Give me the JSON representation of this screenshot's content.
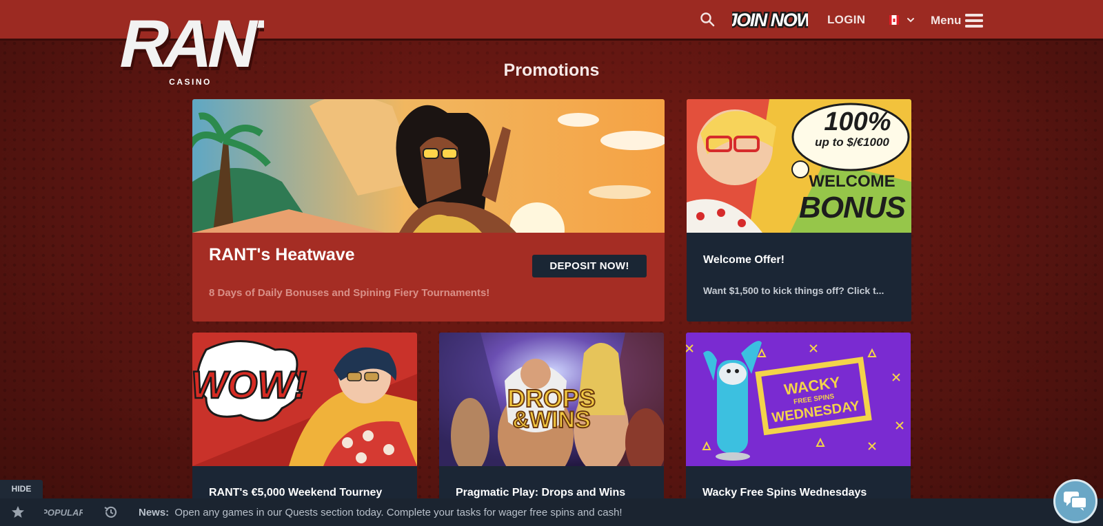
{
  "header": {
    "logo_text": "RANT",
    "logo_sub": "CASINO",
    "join_label": "JOIN NOW",
    "login_label": "LOGIN",
    "menu_label": "Menu"
  },
  "page": {
    "title": "Promotions"
  },
  "promotions": [
    {
      "title": "RANT's Heatwave",
      "subtitle": "8 Days of Daily Bonuses and Spining Fiery Tournaments!",
      "button": "DEPOSIT NOW!"
    },
    {
      "title": "Welcome Offer!",
      "subtitle": "Want $1,500 to kick things off? Click t...",
      "banner_line1": "100%",
      "banner_line2": "up to $/€1000",
      "banner_line3": "WELCOME",
      "banner_line4": "BONUS"
    },
    {
      "title": "RANT's €5,000 Weekend Tourney",
      "banner": "WOW!"
    },
    {
      "title": "Pragmatic Play: Drops and Wins",
      "banner_line1": "DROPS",
      "banner_line2": "&WINS"
    },
    {
      "title": "Wacky Free Spins Wednesdays",
      "banner_line1": "WACKY",
      "banner_line2": "FREE SPINS",
      "banner_line3": "WEDNESDAY"
    }
  ],
  "bottom_bar": {
    "hide_label": "HIDE",
    "popular_label": "POPULAR",
    "news_label": "News:",
    "news_text": "Open any games in our Quests section today. Complete your tasks for wager free spins and cash!"
  },
  "colors": {
    "header_bg": "#9c2a22",
    "page_bg": "#5e1712",
    "card_red": "#a52d24",
    "card_dark": "#1b2635",
    "button_dark": "#1a2634",
    "chat_bubble": "#6aa7c6"
  }
}
